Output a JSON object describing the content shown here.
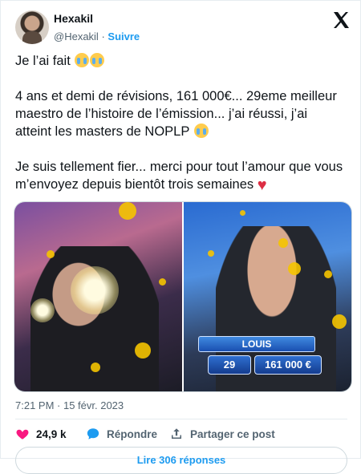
{
  "author": {
    "name": "Hexakil",
    "handle": "@Hexakil",
    "separator": "·",
    "follow_label": "Suivre"
  },
  "tweet": {
    "line1": "Je l’ai fait",
    "paragraph2": "4 ans et demi de révisions, 161 000€... 29eme meilleur maestro de l’histoire de l’émission... j’ai réussi, j’ai atteint les masters de NOPLP",
    "paragraph3": "Je suis tellement fier... merci pour tout l’amour que vous m’envoyez depuis bientôt trois semaines",
    "emoji_names": [
      "loudly-crying-face",
      "loudly-crying-face",
      "loudly-crying-face",
      "red-heart"
    ]
  },
  "media": {
    "overlay_name": "LOUIS",
    "overlay_rank": "29",
    "overlay_amount": "161 000 €"
  },
  "timestamp": "7:21 PM · 15 févr. 2023",
  "actions": {
    "likes": "24,9 k",
    "reply_label": "Répondre",
    "share_label": "Partager ce post"
  },
  "more_replies_label": "Lire 306 réponses",
  "colors": {
    "accent": "#1d9bf0",
    "like": "#f91880",
    "text": "#0f1419",
    "muted": "#536471"
  }
}
